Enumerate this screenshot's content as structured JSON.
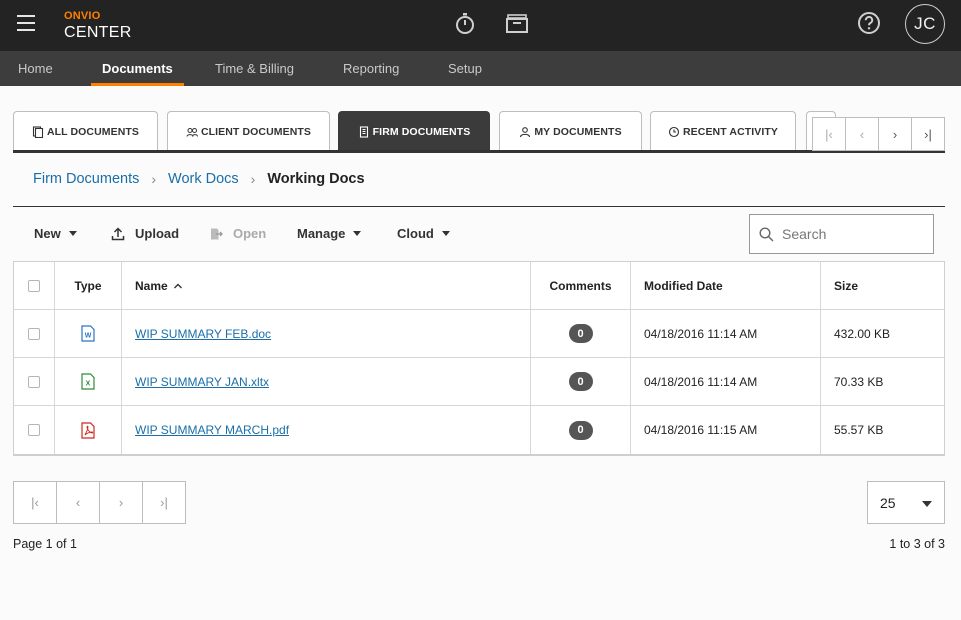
{
  "brand": {
    "top": "ONVIO",
    "bottom": "CENTER"
  },
  "user": {
    "initials": "JC"
  },
  "nav": [
    {
      "label": "Home"
    },
    {
      "label": "Documents",
      "active": true
    },
    {
      "label": "Time & Billing"
    },
    {
      "label": "Reporting"
    },
    {
      "label": "Setup"
    }
  ],
  "tabs": [
    {
      "label": "ALL DOCUMENTS",
      "icon": "documents-icon"
    },
    {
      "label": "CLIENT DOCUMENTS",
      "icon": "people-icon"
    },
    {
      "label": "FIRM DOCUMENTS",
      "icon": "building-icon",
      "active": true
    },
    {
      "label": "MY DOCUMENTS",
      "icon": "person-icon"
    },
    {
      "label": "RECENT ACTIVITY",
      "icon": "clock-icon"
    }
  ],
  "breadcrumb": {
    "items": [
      "Firm Documents",
      "Work Docs"
    ],
    "current": "Working Docs"
  },
  "toolbar": {
    "new": "New",
    "upload": "Upload",
    "open": "Open",
    "manage": "Manage",
    "cloud": "Cloud"
  },
  "search": {
    "placeholder": "Search",
    "value": ""
  },
  "table": {
    "headers": {
      "type": "Type",
      "name": "Name",
      "comments": "Comments",
      "modified": "Modified Date",
      "size": "Size"
    },
    "rows": [
      {
        "type": "word",
        "name": "WIP SUMMARY FEB.doc",
        "comments": "0",
        "modified": "04/18/2016 11:14 AM",
        "size": "432.00 KB"
      },
      {
        "type": "excel",
        "name": "WIP SUMMARY JAN.xltx",
        "comments": "0",
        "modified": "04/18/2016 11:14 AM",
        "size": "70.33 KB"
      },
      {
        "type": "pdf",
        "name": "WIP SUMMARY MARCH.pdf",
        "comments": "0",
        "modified": "04/18/2016 11:15 AM",
        "size": "55.57 KB"
      }
    ]
  },
  "pagination": {
    "page_size": "25",
    "page_info": "Page 1 of 1",
    "range_info": "1 to 3 of 3"
  },
  "colors": {
    "accent": "#ff8000",
    "link": "#1a6fa6",
    "topbar": "#232323",
    "navbar": "#3d3d3d"
  }
}
